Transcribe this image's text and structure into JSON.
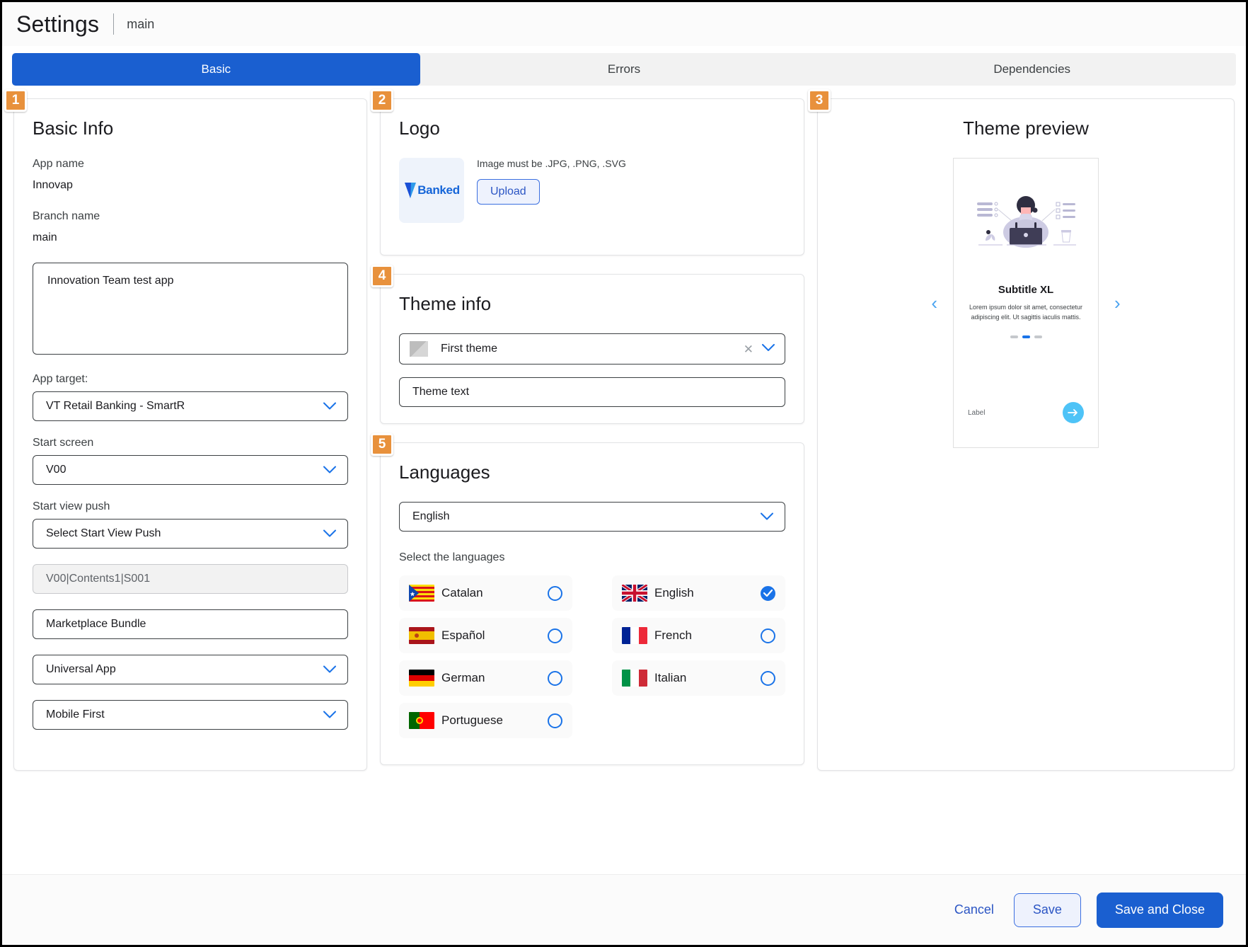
{
  "header": {
    "title": "Settings",
    "branch": "main"
  },
  "tabs": [
    {
      "label": "Basic",
      "active": true
    },
    {
      "label": "Errors",
      "active": false
    },
    {
      "label": "Dependencies",
      "active": false
    }
  ],
  "basic_info": {
    "step": "1",
    "title": "Basic Info",
    "app_name_label": "App name",
    "app_name_value": "Innovap",
    "branch_name_label": "Branch name",
    "branch_name_value": "main",
    "description_value": "Innovation Team test app",
    "app_target_label": "App target:",
    "app_target_value": "VT Retail Banking - SmartR",
    "start_screen_label": "Start screen",
    "start_screen_value": "V00",
    "start_view_push_label": "Start view push",
    "start_view_push_value": "Select Start View Push",
    "path_value": "V00|Contents1|S001",
    "bundle_value": "Marketplace Bundle",
    "app_kind_value": "Universal App",
    "approach_value": "Mobile First"
  },
  "logo": {
    "step": "2",
    "title": "Logo",
    "brand_text": "Banked",
    "hint": "Image must be .JPG, .PNG, .SVG",
    "upload_label": "Upload"
  },
  "theme_info": {
    "step": "4",
    "title": "Theme info",
    "selected_theme": "First theme",
    "theme_text_value": "Theme text"
  },
  "languages": {
    "step": "5",
    "title": "Languages",
    "selected": "English",
    "select_label": "Select the languages",
    "items": [
      {
        "name": "Catalan",
        "selected": false
      },
      {
        "name": "English",
        "selected": true
      },
      {
        "name": "Español",
        "selected": false
      },
      {
        "name": "French",
        "selected": false
      },
      {
        "name": "German",
        "selected": false
      },
      {
        "name": "Italian",
        "selected": false
      },
      {
        "name": "Portuguese",
        "selected": false
      }
    ]
  },
  "theme_preview": {
    "step": "3",
    "title": "Theme preview",
    "prev_icon": "‹",
    "next_icon": "›",
    "subtitle": "Subtitle XL",
    "body": "Lorem ipsum dolor sit amet, consectetur adipiscing elit. Ut sagittis iaculis mattis.",
    "label": "Label"
  },
  "footer": {
    "cancel_label": "Cancel",
    "save_label": "Save",
    "save_close_label": "Save and Close"
  },
  "colors": {
    "accent_blue": "#1a5fd0",
    "step_orange": "#e8913c",
    "link_blue": "#2b55c4",
    "radio_blue": "#1a73e8",
    "fab_cyan": "#4ec3f7"
  }
}
